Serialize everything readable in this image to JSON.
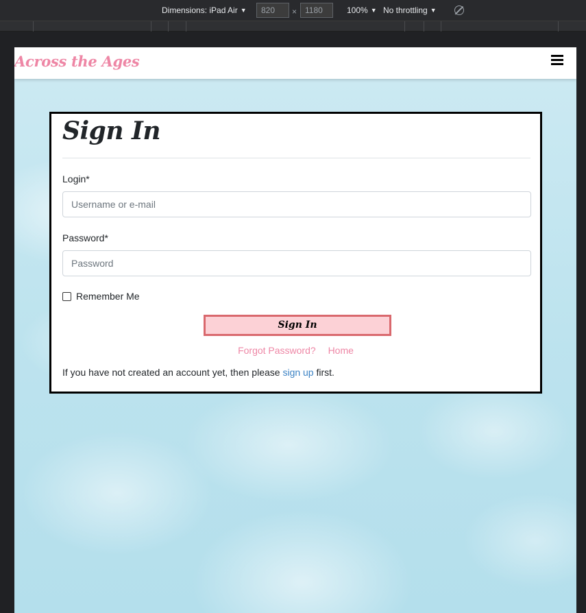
{
  "devtools": {
    "dimensions_label": "Dimensions: iPad Air",
    "width_value": "820",
    "times": "×",
    "height_value": "1180",
    "zoom": "100%",
    "throttling": "No throttling"
  },
  "navbar": {
    "brand": "Across the Ages",
    "menu_icon": "hamburger-icon"
  },
  "signin": {
    "title": "Sign In",
    "login_label": "Login*",
    "login_placeholder": "Username or e-mail",
    "password_label": "Password*",
    "password_placeholder": "Password",
    "remember_label": "Remember Me",
    "submit_label": "Sign In",
    "forgot_label": "Forgot Password?",
    "home_label": "Home",
    "footer_prefix": "If you have not created an account yet, then please",
    "signup_label": "sign up",
    "footer_suffix": "first."
  },
  "colors": {
    "brand": "#ee86a5",
    "button_bg": "#fcd1d6",
    "button_border": "#d9686d",
    "link": "#3b82c4"
  }
}
